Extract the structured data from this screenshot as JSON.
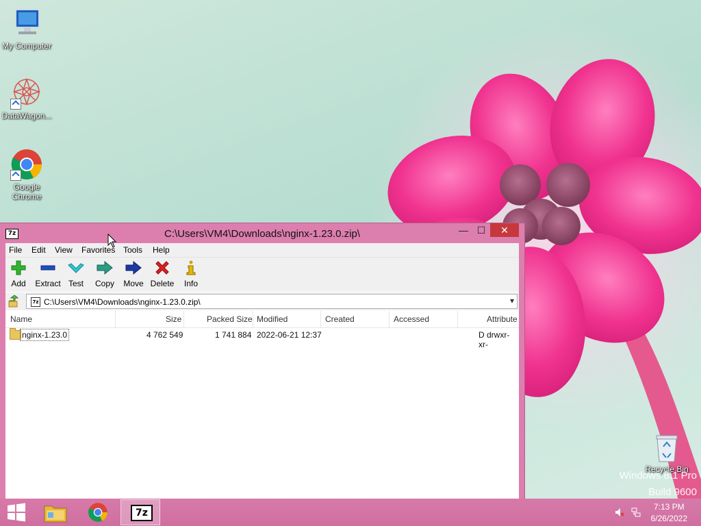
{
  "desktop": {
    "icons": [
      {
        "label": "My Computer"
      },
      {
        "label": "DataWagon..."
      },
      {
        "label": "Google Chrome"
      },
      {
        "label": "Recycle Bin"
      }
    ],
    "watermark_line1": "Windows 8.1 Pro",
    "watermark_line2": "Build 9600"
  },
  "window": {
    "title": "C:\\Users\\VM4\\Downloads\\nginx-1.23.0.zip\\",
    "app_logo": "7z",
    "controls": {
      "minimize": "—",
      "maximize": "☐",
      "close": "✕"
    },
    "menu": [
      "File",
      "Edit",
      "View",
      "Favorites",
      "Tools",
      "Help"
    ],
    "toolbar": [
      {
        "label": "Add",
        "icon": "plus-icon"
      },
      {
        "label": "Extract",
        "icon": "minus-icon"
      },
      {
        "label": "Test",
        "icon": "check-icon"
      },
      {
        "label": "Copy",
        "icon": "copy-arrow-icon"
      },
      {
        "label": "Move",
        "icon": "move-arrow-icon"
      },
      {
        "label": "Delete",
        "icon": "delete-x-icon"
      },
      {
        "label": "Info",
        "icon": "info-icon"
      }
    ],
    "address": "C:\\Users\\VM4\\Downloads\\nginx-1.23.0.zip\\",
    "columns": [
      "Name",
      "Size",
      "Packed Size",
      "Modified",
      "Created",
      "Accessed",
      "Attribute"
    ],
    "rows": [
      {
        "name": "nginx-1.23.0",
        "size": "4 762 549",
        "packed": "1 741 884",
        "modified": "2022-06-21 12:37",
        "created": "",
        "accessed": "",
        "attributes": "D drwxr-xr-"
      }
    ]
  },
  "taskbar": {
    "items": [
      "start",
      "file-explorer",
      "google-chrome",
      "7-zip"
    ],
    "time": "7:13 PM",
    "date": "6/26/2022"
  },
  "colors": {
    "window_frame": "#dc7fae",
    "taskbar": "#d77aa9",
    "close_button": "#c7383c"
  }
}
